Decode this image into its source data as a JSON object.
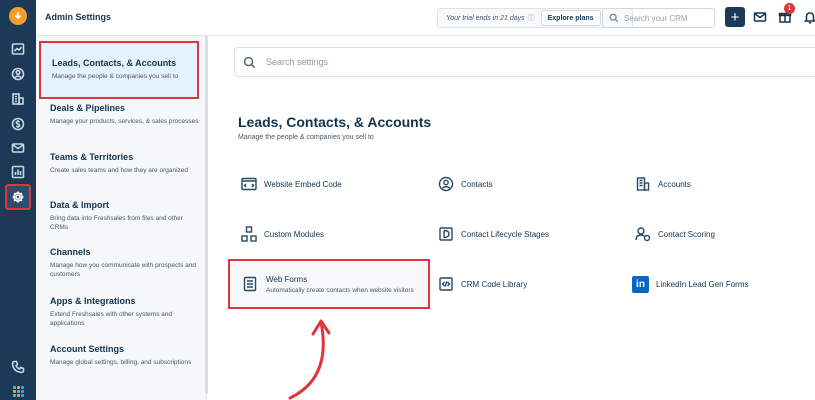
{
  "topbar": {
    "title": "Admin Settings",
    "trial_text": "Your trial ends in 21 days",
    "explore_label": "Explore plans",
    "search_placeholder": "Search your CRM",
    "add_label": "+",
    "notification_count": "1"
  },
  "nav": {
    "items": [
      {
        "title": "Leads, Contacts, & Accounts",
        "desc": "Manage the people & companies you sell to"
      },
      {
        "title": "Deals & Pipelines",
        "desc": "Manage your products, services, & sales processes"
      },
      {
        "title": "Teams & Territories",
        "desc": "Create sales teams and how they are organized"
      },
      {
        "title": "Data & Import",
        "desc": "Bring data into Freshsales from files and other CRMs"
      },
      {
        "title": "Channels",
        "desc": "Manage how you communicate with prospects and customers"
      },
      {
        "title": "Apps & Integrations",
        "desc": "Extend Freshsales with other systems and applications"
      },
      {
        "title": "Account Settings",
        "desc": "Manage global settings, billing, and subscriptions"
      }
    ]
  },
  "main": {
    "search_placeholder": "Search settings",
    "section_title": "Leads, Contacts, & Accounts",
    "section_subtitle": "Manage the people & companies you sell to",
    "cards": {
      "website_embed_code": "Website Embed Code",
      "contacts": "Contacts",
      "accounts": "Accounts",
      "custom_modules": "Custom Modules",
      "contact_lifecycle_stages": "Contact Lifecycle Stages",
      "contact_scoring": "Contact Scoring",
      "web_forms": "Web Forms",
      "web_forms_desc": "Automatically create contacts when website visitors",
      "crm_code_library": "CRM Code Library",
      "linkedin_lead_gen_forms": "LinkedIn Lead Gen Forms"
    }
  },
  "colors": {
    "rail_bg": "#1c3a57",
    "highlight_red": "#e0353a",
    "active_nav_bg": "#e5f2fd"
  }
}
